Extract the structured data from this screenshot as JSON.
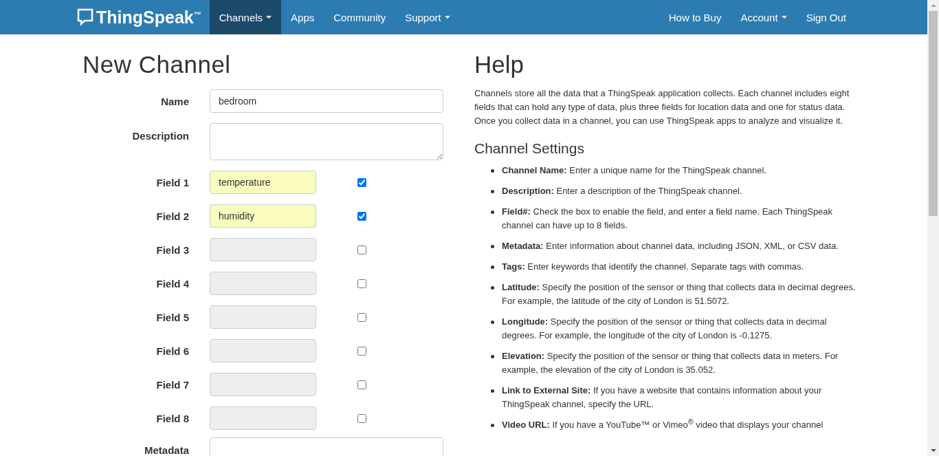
{
  "navbar": {
    "brand": "ThingSpeak",
    "brand_mark": "™",
    "left_items": [
      {
        "label": "Channels",
        "dropdown": true,
        "selected": true
      },
      {
        "label": "Apps",
        "dropdown": false,
        "selected": false
      },
      {
        "label": "Community",
        "dropdown": false,
        "selected": false
      },
      {
        "label": "Support",
        "dropdown": true,
        "selected": false
      }
    ],
    "right_items": [
      {
        "label": "How to Buy",
        "dropdown": false
      },
      {
        "label": "Account",
        "dropdown": true
      },
      {
        "label": "Sign Out",
        "dropdown": false
      }
    ]
  },
  "form": {
    "title": "New Channel",
    "name": {
      "label": "Name",
      "value": "bedroom"
    },
    "description": {
      "label": "Description"
    },
    "fields": [
      {
        "label": "Field 1",
        "value": "temperature",
        "checked": true
      },
      {
        "label": "Field 2",
        "value": "humidity",
        "checked": true
      },
      {
        "label": "Field 3",
        "checked": false
      },
      {
        "label": "Field 4",
        "checked": false
      },
      {
        "label": "Field 5",
        "checked": false
      },
      {
        "label": "Field 6",
        "checked": false
      },
      {
        "label": "Field 7",
        "checked": false
      },
      {
        "label": "Field 8",
        "checked": false
      }
    ],
    "metadata": {
      "label": "Metadata"
    }
  },
  "help": {
    "title": "Help",
    "intro": "Channels store all the data that a ThingSpeak application collects. Each channel includes eight fields that can hold any type of data, plus three fields for location data and one for status data. Once you collect data in a channel, you can use ThingSpeak apps to analyze and visualize it.",
    "section_title": "Channel Settings",
    "items": [
      {
        "term": "Channel Name:",
        "text": "Enter a unique name for the ThingSpeak channel."
      },
      {
        "term": "Description:",
        "text": "Enter a description of the ThingSpeak channel."
      },
      {
        "term": "Field#:",
        "text": "Check the box to enable the field, and enter a field name. Each ThingSpeak channel can have up to 8 fields."
      },
      {
        "term": "Metadata:",
        "text": "Enter information about channel data, including JSON, XML, or CSV data."
      },
      {
        "term": "Tags:",
        "text": "Enter keywords that identify the channel. Separate tags with commas."
      },
      {
        "term": "Latitude:",
        "text": "Specify the position of the sensor or thing that collects data in decimal degrees. For example, the latitude of the city of London is 51.5072."
      },
      {
        "term": "Longitude:",
        "text": "Specify the position of the sensor or thing that collects data in decimal degrees. For example, the longitude of the city of London is -0.1275."
      },
      {
        "term": "Elevation:",
        "text": "Specify the position of the sensor or thing that collects data in meters. For example, the elevation of the city of London is 35.052."
      },
      {
        "term": "Link to External Site:",
        "text": "If you have a website that contains information about your ThingSpeak channel, specify the URL."
      },
      {
        "term": "Video URL:",
        "text": "If you have a YouTube™ or Vimeo$^{®}$ video that displays your channel"
      }
    ]
  }
}
